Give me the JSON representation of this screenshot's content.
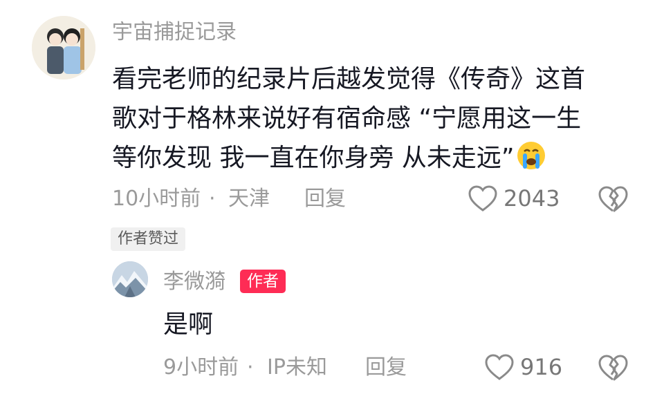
{
  "comment": {
    "username": "宇宙捕捉记录",
    "avatar_icon": "couple-avatar-icon",
    "lines": [
      "看完老师的纪录片后越发觉得《传奇》这首",
      "歌对于格林来说好有宿命感 “宁愿用这一生",
      "等你发现 我一直在你身旁 从未走远”"
    ],
    "emoji": "crying-face-emoji",
    "time": "10小时前",
    "separator": "·",
    "location": "天津",
    "reply_label": "回复",
    "likes": "2043",
    "author_liked_badge": "作者赞过"
  },
  "reply": {
    "username": "李微漪",
    "author_tag": "作者",
    "avatar_icon": "snow-mountain-avatar-icon",
    "text": "是啊",
    "time": "9小时前",
    "separator": "·",
    "location": "IP未知",
    "reply_label": "回复",
    "likes": "916"
  },
  "colors": {
    "accent": "#fe2c55",
    "meta_gray": "#9a9a9a",
    "text": "#161823"
  }
}
